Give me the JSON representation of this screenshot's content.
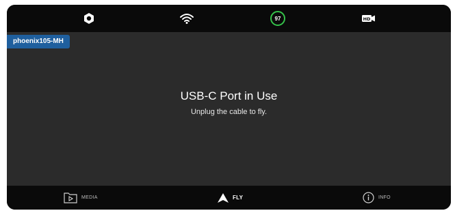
{
  "topbar": {
    "settings_icon": "hexagon-settings-icon",
    "wifi_icon": "wifi-icon",
    "battery_level": "97",
    "battery_color": "#35c24a",
    "video_icon": "hd-video-icon"
  },
  "drone": {
    "name": "phoenix105-MH",
    "tag_color": "#1f5f9e"
  },
  "message": {
    "title": "USB-C Port in Use",
    "subtitle": "Unplug the cable to fly."
  },
  "nav": {
    "media_label": "MEDIA",
    "fly_label": "FLY",
    "info_label": "INFO",
    "active": "FLY"
  }
}
